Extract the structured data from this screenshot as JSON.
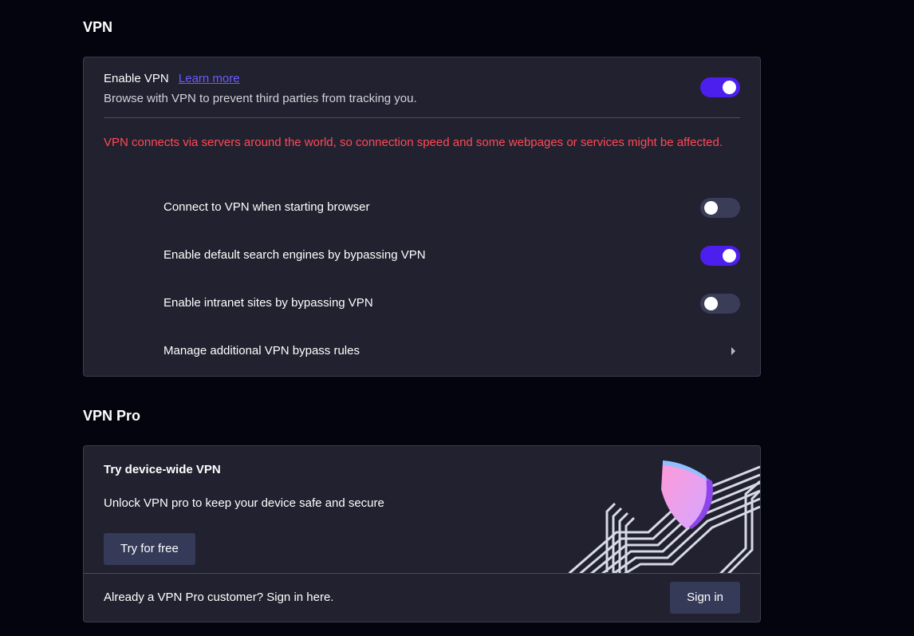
{
  "vpn_section": {
    "title": "VPN",
    "enable": {
      "label": "Enable VPN",
      "learn_more": "Learn more",
      "description": "Browse with VPN to prevent third parties from tracking you.",
      "enabled": true
    },
    "warning": "VPN connects via servers around the world, so connection speed and some webpages or services might be affected.",
    "options": [
      {
        "label": "Connect to VPN when starting browser",
        "enabled": false
      },
      {
        "label": "Enable default search engines by bypassing VPN",
        "enabled": true
      },
      {
        "label": "Enable intranet sites by bypassing VPN",
        "enabled": false
      }
    ],
    "manage_link": "Manage additional VPN bypass rules"
  },
  "vpn_pro_section": {
    "title": "VPN Pro",
    "card_title": "Try device-wide VPN",
    "card_description": "Unlock VPN pro to keep your device safe and secure",
    "try_button": "Try for free",
    "footer_text": "Already a VPN Pro customer? Sign in here.",
    "sign_in_button": "Sign in"
  },
  "colors": {
    "background": "#03040d",
    "card": "#21212f",
    "accent": "#4c1fef",
    "link": "#6b5cff",
    "warning": "#ff4a57",
    "button": "#353a58"
  },
  "icons": {
    "manage_chevron": "chevron-right-icon",
    "illustration": "shield-icon"
  }
}
